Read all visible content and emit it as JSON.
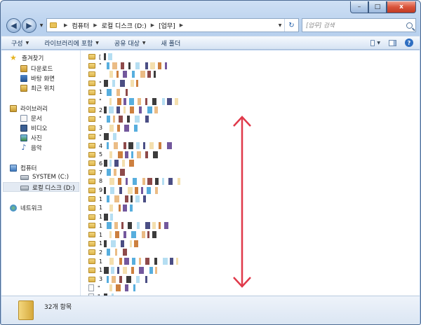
{
  "window": {
    "caption_buttons": {
      "minimize": "–",
      "maximize": "□",
      "close": "x"
    }
  },
  "address": {
    "breadcrumbs": [
      "컴퓨터",
      "로컬 디스크 (D:)",
      "[업무]"
    ],
    "search_placeholder": "[업무] 검색"
  },
  "toolbar": {
    "items": [
      "구성",
      "라이브러리에 포함",
      "공유 대상",
      "새 폴더"
    ],
    "help_label": "?"
  },
  "nav": {
    "favorites": {
      "label": "즐겨찾기",
      "items": [
        "다운로드",
        "바탕 화면",
        "최근 위치"
      ]
    },
    "libraries": {
      "label": "라이브러리",
      "items": [
        "문서",
        "비디오",
        "사진",
        "음악"
      ]
    },
    "computer": {
      "label": "컴퓨터",
      "items": [
        "SYSTEM (C:)",
        "로컬 디스크 (D:)"
      ]
    },
    "network": {
      "label": "네트워크"
    }
  },
  "files": [
    "[",
    "\"",
    "",
    "\"",
    "1",
    "\"",
    "2",
    "\"",
    "3",
    "\"",
    "4",
    "5",
    "6",
    "7",
    "8",
    "9",
    "1",
    "1",
    "1",
    "1",
    "1",
    "1",
    "2",
    "1",
    "1",
    "3",
    "\"",
    "\"",
    "\"",
    "\"",
    "\"",
    "전"
  ],
  "status": {
    "count": "32개 항목"
  },
  "colors": {
    "arrow": "#e0394a",
    "window_frame": "#a9c4e6"
  }
}
